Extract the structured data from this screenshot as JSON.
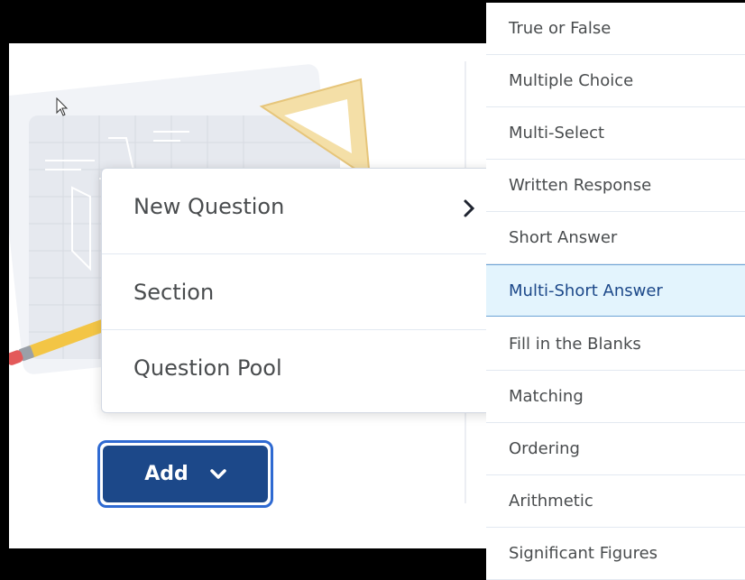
{
  "menu": {
    "items": [
      {
        "label": "New Question",
        "has_submenu": true
      },
      {
        "label": "Section"
      },
      {
        "label": "Question Pool"
      }
    ]
  },
  "add_button": {
    "label": "Add",
    "icon": "chevron-down-icon"
  },
  "submenu": {
    "items": [
      {
        "label": "True or False"
      },
      {
        "label": "Multiple Choice"
      },
      {
        "label": "Multi-Select"
      },
      {
        "label": "Written Response"
      },
      {
        "label": "Short Answer"
      },
      {
        "label": "Multi-Short Answer",
        "highlighted": true
      },
      {
        "label": "Fill in the Blanks"
      },
      {
        "label": "Matching"
      },
      {
        "label": "Ordering"
      },
      {
        "label": "Arithmetic"
      },
      {
        "label": "Significant Figures"
      }
    ]
  },
  "colors": {
    "primary_button": "#1c4889",
    "focus_ring": "#2f6ad2",
    "highlight_bg": "#e3f4fd",
    "highlight_border": "#6da3d6"
  }
}
